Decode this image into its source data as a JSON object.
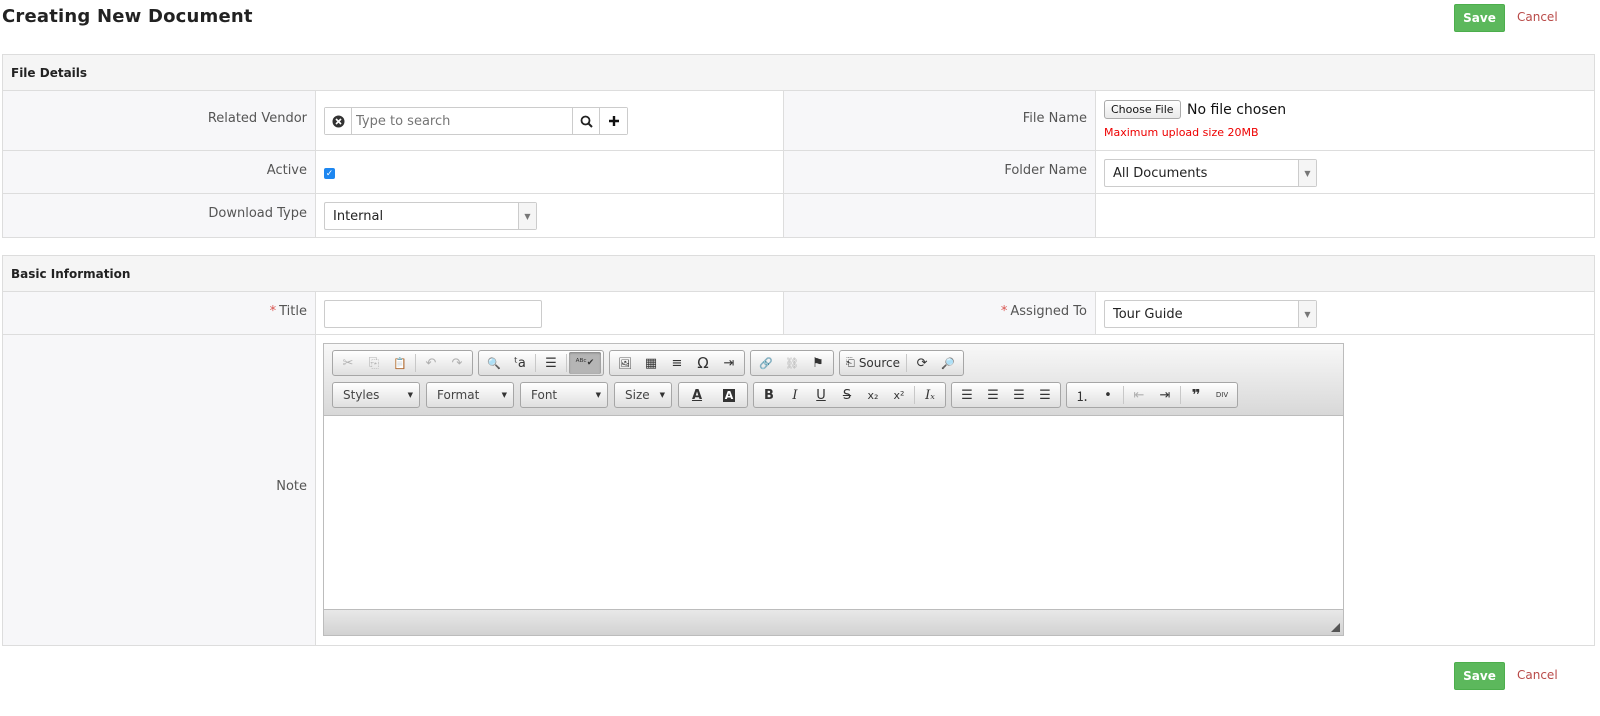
{
  "page": {
    "title": "Creating New Document",
    "save_label": "Save",
    "cancel_label": "Cancel"
  },
  "file_details": {
    "heading": "File Details",
    "related_vendor": {
      "label": "Related Vendor",
      "placeholder": "Type to search"
    },
    "file_name": {
      "label": "File Name",
      "button": "Choose File",
      "status": "No file chosen",
      "note": "Maximum upload size 20MB"
    },
    "active": {
      "label": "Active",
      "checked": true
    },
    "folder_name": {
      "label": "Folder Name",
      "value": "All Documents"
    },
    "download_type": {
      "label": "Download Type",
      "value": "Internal"
    }
  },
  "basic_information": {
    "heading": "Basic Information",
    "title": {
      "label": "Title",
      "required_mark": "*",
      "value": ""
    },
    "assigned_to": {
      "label": "Assigned To",
      "required_mark": "*",
      "value": "Tour Guide"
    },
    "note": {
      "label": "Note"
    }
  },
  "editor": {
    "source_label": "Source",
    "combos": {
      "styles": "Styles",
      "format": "Format",
      "font": "Font",
      "size": "Size"
    },
    "glyphs": {
      "cut": "✂",
      "copy": "⎘",
      "paste": "📋",
      "undo": "↶",
      "redo": "↷",
      "find": "🔍",
      "replace": "ᵗa",
      "select_all": "☰",
      "spellcheck": "ᴬᴮᶜ✔",
      "image": "🖼",
      "table": "▦",
      "hr": "≡",
      "special_char": "Ω",
      "indent_block": "⇥",
      "link": "🔗",
      "unlink": "⛓",
      "anchor": "⚑",
      "templates": "⟳",
      "preview": "🔎",
      "text_color": "A",
      "bg_color": "A",
      "bold": "B",
      "italic": "I",
      "underline": "U",
      "strike": "S",
      "subscript": "x₂",
      "superscript": "x²",
      "remove_format": "Iₓ",
      "align_left": "☰",
      "align_center": "☰",
      "align_right": "☰",
      "justify": "☰",
      "numbered_list": "⒈",
      "bullet_list": "•",
      "outdent": "⇤",
      "indent": "⇥",
      "blockquote": "❞",
      "div": "DIV"
    }
  }
}
